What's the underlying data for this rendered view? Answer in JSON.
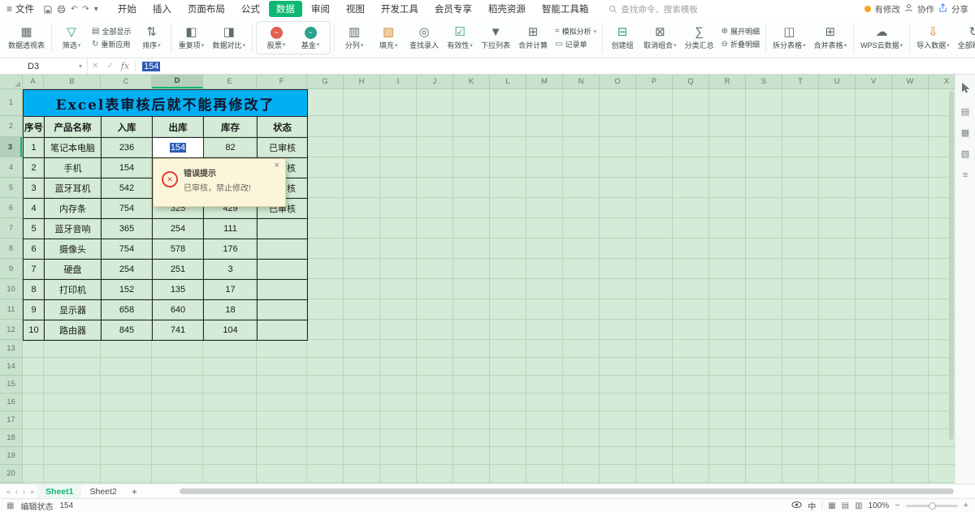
{
  "menubar": {
    "file_label": "文件",
    "tabs": [
      {
        "label": "开始",
        "active": false
      },
      {
        "label": "插入",
        "active": false
      },
      {
        "label": "页面布局",
        "active": false
      },
      {
        "label": "公式",
        "active": false
      },
      {
        "label": "数据",
        "active": true
      },
      {
        "label": "审阅",
        "active": false
      },
      {
        "label": "视图",
        "active": false
      },
      {
        "label": "开发工具",
        "active": false
      },
      {
        "label": "会员专享",
        "active": false
      },
      {
        "label": "稻壳资源",
        "active": false
      },
      {
        "label": "智能工具箱",
        "active": false
      }
    ],
    "search_placeholder": "查找命令、搜索模板",
    "modified_label": "有修改",
    "collab_label": "协作",
    "share_label": "分享"
  },
  "ribbon": {
    "groups": [
      {
        "items": [
          {
            "type": "big",
            "label": "数据透视表",
            "icon": "pivot-table-icon"
          }
        ]
      },
      {
        "items": [
          {
            "type": "big",
            "label": "筛选",
            "caret": true,
            "icon": "funnel-icon"
          },
          {
            "type": "stack",
            "rows": [
              {
                "label": "全部显示",
                "icon": "show-all-icon"
              },
              {
                "label": "重新应用",
                "icon": "reapply-icon"
              }
            ]
          },
          {
            "type": "big",
            "label": "排序",
            "caret": true,
            "icon": "sort-icon"
          }
        ]
      },
      {
        "items": [
          {
            "type": "big",
            "label": "重复项",
            "caret": true,
            "icon": "duplicates-icon"
          },
          {
            "type": "big",
            "label": "数据对比",
            "caret": true,
            "icon": "compare-icon"
          }
        ]
      },
      {
        "boxed": true,
        "items": [
          {
            "type": "big",
            "label": "股票",
            "caret": true,
            "icon": "stock-icon"
          },
          {
            "type": "big",
            "label": "基金",
            "caret": true,
            "icon": "fund-icon"
          }
        ]
      },
      {
        "items": [
          {
            "type": "big",
            "label": "分列",
            "caret": true,
            "icon": "split-columns-icon"
          },
          {
            "type": "big",
            "label": "填充",
            "caret": true,
            "icon": "fill-icon"
          },
          {
            "type": "big",
            "label": "查找录入",
            "icon": "lookup-entry-icon"
          },
          {
            "type": "big",
            "label": "有效性",
            "caret": true,
            "icon": "validation-icon"
          },
          {
            "type": "big",
            "label": "下拉列表",
            "icon": "dropdown-list-icon"
          },
          {
            "type": "big",
            "label": "合并计算",
            "icon": "consolidate-icon"
          },
          {
            "type": "stack",
            "rows": [
              {
                "label": "模拟分析",
                "icon": "what-if-icon",
                "caret": true
              },
              {
                "label": "记录单",
                "icon": "record-form-icon"
              }
            ]
          }
        ]
      },
      {
        "items": [
          {
            "type": "big",
            "label": "创建组",
            "icon": "create-group-icon"
          },
          {
            "type": "big",
            "label": "取消组合",
            "caret": true,
            "icon": "ungroup-icon"
          },
          {
            "type": "big",
            "label": "分类汇总",
            "icon": "subtotal-icon"
          },
          {
            "type": "stack",
            "rows": [
              {
                "label": "展开明细",
                "icon": "expand-detail-icon"
              },
              {
                "label": "折叠明细",
                "icon": "collapse-detail-icon"
              }
            ]
          }
        ]
      },
      {
        "items": [
          {
            "type": "big",
            "label": "拆分表格",
            "caret": true,
            "icon": "split-table-icon"
          },
          {
            "type": "big",
            "label": "合并表格",
            "caret": true,
            "icon": "merge-table-icon"
          }
        ]
      },
      {
        "items": [
          {
            "type": "big",
            "label": "WPS云数据",
            "caret": true,
            "icon": "cloud-data-icon"
          }
        ]
      },
      {
        "items": [
          {
            "type": "big",
            "label": "导入数据",
            "caret": true,
            "icon": "import-data-icon"
          },
          {
            "type": "big",
            "label": "全部刷新",
            "caret": true,
            "icon": "refresh-all-icon"
          }
        ]
      }
    ]
  },
  "formula_bar": {
    "cell_ref": "D3",
    "value": "154",
    "fx_label": "fx"
  },
  "grid": {
    "columns": [
      "A",
      "B",
      "C",
      "D",
      "E",
      "F",
      "G",
      "H",
      "I",
      "J",
      "K",
      "L",
      "M",
      "N",
      "O",
      "P",
      "Q",
      "R",
      "S",
      "T",
      "U",
      "V",
      "W",
      "X"
    ],
    "rows": 21,
    "selected_col": "D",
    "selected_row": 3
  },
  "table": {
    "title": "Excel表审核后就不能再修改了",
    "headers": [
      "序号",
      "产品名称",
      "入库",
      "出库",
      "库存",
      "状态"
    ],
    "rows": [
      [
        "1",
        "笔记本电脑",
        "236",
        "154",
        "82",
        "已审核"
      ],
      [
        "2",
        "手机",
        "154",
        "",
        "",
        "已审核"
      ],
      [
        "3",
        "蓝牙耳机",
        "542",
        "",
        "",
        "已审核"
      ],
      [
        "4",
        "内存条",
        "754",
        "325",
        "429",
        "已审核"
      ],
      [
        "5",
        "蓝牙音响",
        "365",
        "254",
        "111",
        ""
      ],
      [
        "6",
        "摄像头",
        "754",
        "578",
        "176",
        ""
      ],
      [
        "7",
        "硬盘",
        "254",
        "251",
        "3",
        ""
      ],
      [
        "8",
        "打印机",
        "152",
        "135",
        "17",
        ""
      ],
      [
        "9",
        "显示器",
        "658",
        "640",
        "18",
        ""
      ],
      [
        "10",
        "路由器",
        "845",
        "741",
        "104",
        ""
      ]
    ],
    "selected": {
      "row": 0,
      "col": 3,
      "value": "154"
    }
  },
  "error_dialog": {
    "title": "错误提示",
    "message": "已审核，禁止修改!",
    "close": "×"
  },
  "sheet_bar": {
    "tabs": [
      {
        "label": "Sheet1",
        "active": true
      },
      {
        "label": "Sheet2",
        "active": false
      }
    ],
    "add_label": "+"
  },
  "status_bar": {
    "mode_label": "编辑状态",
    "value": "154",
    "lang": "中",
    "zoom": "100%"
  },
  "colors": {
    "accent": "#0eb872",
    "title_fill": "#00b0f0",
    "selection_blue": "#2d5cb8",
    "error_red": "#e23c39",
    "grid_bg": "#d3ebd7",
    "header_bg": "#c9e2cd",
    "gridline": "#b9d6bd",
    "table_border": "#262626"
  }
}
